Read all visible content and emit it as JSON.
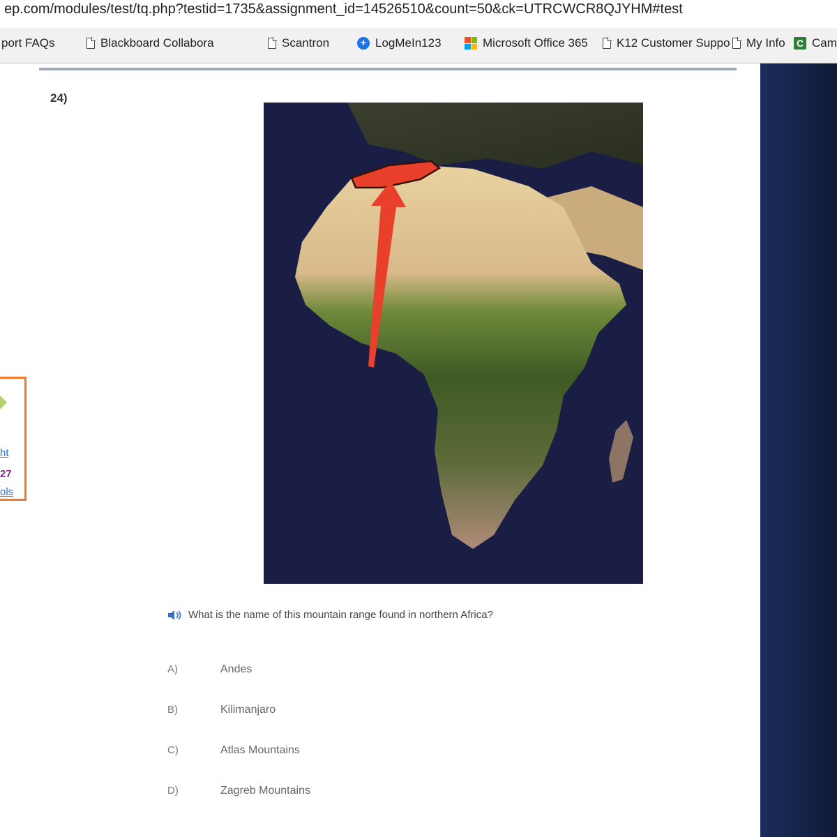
{
  "browser": {
    "url": "ep.com/modules/test/tq.php?testid=1735&assignment_id=14526510&count=50&ck=UTRCWCR8QJYHM#test",
    "bookmarks": [
      {
        "label": "port FAQs",
        "icon": "none"
      },
      {
        "label": "Blackboard Collabora",
        "icon": "page-icon"
      },
      {
        "label": "Scantron",
        "icon": "page-icon"
      },
      {
        "label": "LogMeIn123",
        "icon": "logmein-icon"
      },
      {
        "label": "Microsoft Office 365",
        "icon": "microsoft-icon"
      },
      {
        "label": "K12 Customer Suppo",
        "icon": "page-icon"
      },
      {
        "label": "My Info",
        "icon": "page-icon"
      },
      {
        "label": "Camp",
        "icon": "camp-icon"
      }
    ]
  },
  "sidebar": {
    "line1": "ht",
    "line2": "27",
    "line3": "ols"
  },
  "question": {
    "number": "24)",
    "text": "What is the name of this mountain range found in northern Africa?",
    "answers": [
      {
        "letter": "A)",
        "text": "Andes"
      },
      {
        "letter": "B)",
        "text": "Kilimanjaro"
      },
      {
        "letter": "C)",
        "text": "Atlas Mountains"
      },
      {
        "letter": "D)",
        "text": "Zagreb Mountains"
      }
    ]
  },
  "colors": {
    "highlight": "#e8402a",
    "widget_border": "#f07a2c"
  }
}
